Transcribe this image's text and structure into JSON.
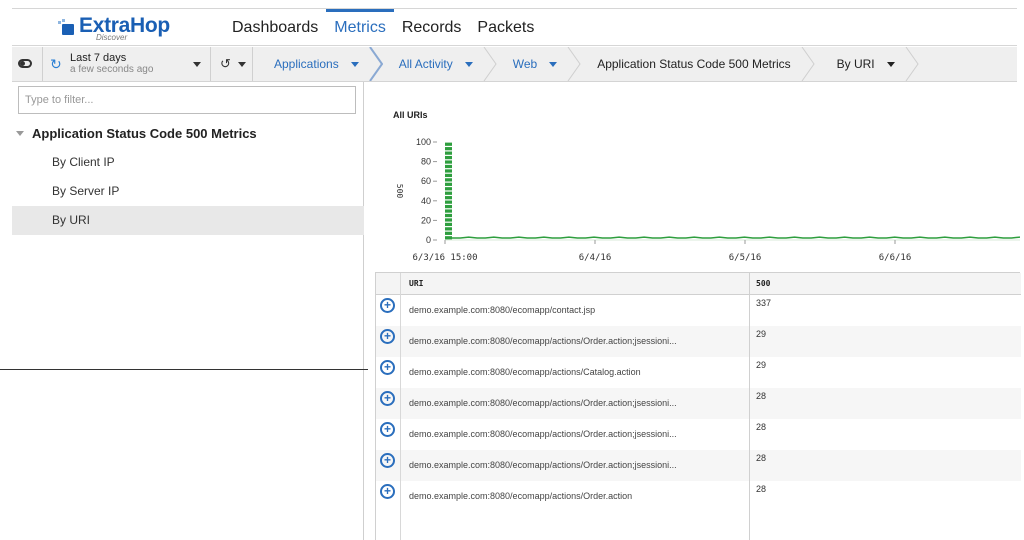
{
  "header": {
    "logo_text": "ExtraHop",
    "logo_sub": "Discover",
    "nav": [
      {
        "label": "Dashboards"
      },
      {
        "label": "Metrics"
      },
      {
        "label": "Records"
      },
      {
        "label": "Packets"
      }
    ],
    "active_nav": "Metrics",
    "brand_color": "#1a5fb4"
  },
  "toolbar": {
    "time_range": "Last 7 days",
    "time_updated": "a few seconds ago",
    "breadcrumbs": [
      {
        "label": "Applications",
        "has_dropdown": true
      },
      {
        "label": "All Activity",
        "has_dropdown": true
      },
      {
        "label": "Web",
        "has_dropdown": true
      },
      {
        "label": "Application Status Code 500 Metrics",
        "has_dropdown": false
      },
      {
        "label": "By URI",
        "has_dropdown": true
      }
    ]
  },
  "sidebar": {
    "filter_placeholder": "Type to filter...",
    "root_label": "Application Status Code 500 Metrics",
    "items": [
      {
        "label": "By Client IP"
      },
      {
        "label": "By Server IP"
      },
      {
        "label": "By URI",
        "selected": true
      }
    ]
  },
  "chart_data": {
    "type": "bar",
    "title": "All URIs",
    "ylabel": "500",
    "ylim": [
      0,
      100
    ],
    "yticks": [
      0,
      20,
      40,
      60,
      80,
      100
    ],
    "xticks": [
      "6/3/16 15:00",
      "6/4/16",
      "6/5/16",
      "6/6/16"
    ],
    "series": [
      {
        "values": [
          100,
          2,
          2,
          3,
          2,
          2,
          3,
          2,
          2,
          3,
          2,
          2,
          3,
          2,
          2,
          3,
          2,
          2,
          3,
          2,
          2,
          3,
          2,
          2,
          3,
          2,
          2,
          3,
          2,
          2,
          3,
          2,
          2,
          3,
          2,
          2,
          3,
          2,
          2,
          3,
          2,
          2,
          3,
          2,
          2,
          3,
          2,
          2,
          3,
          2,
          2,
          3,
          2,
          2,
          3,
          2,
          2,
          3,
          2,
          2,
          3,
          2,
          2,
          3,
          2,
          2,
          3,
          2,
          2,
          3
        ]
      }
    ],
    "color": "#2e9e3e"
  },
  "table": {
    "columns": [
      "URI",
      "500"
    ],
    "rows": [
      {
        "uri": "demo.example.com:8080/ecomapp/contact.jsp",
        "value": "337"
      },
      {
        "uri": "demo.example.com:8080/ecomapp/actions/Order.action;jsessioni...",
        "value": "29"
      },
      {
        "uri": "demo.example.com:8080/ecomapp/actions/Catalog.action",
        "value": "29"
      },
      {
        "uri": "demo.example.com:8080/ecomapp/actions/Order.action;jsessioni...",
        "value": "28"
      },
      {
        "uri": "demo.example.com:8080/ecomapp/actions/Order.action;jsessioni...",
        "value": "28"
      },
      {
        "uri": "demo.example.com:8080/ecomapp/actions/Order.action;jsessioni...",
        "value": "28"
      },
      {
        "uri": "demo.example.com:8080/ecomapp/actions/Order.action",
        "value": "28"
      }
    ]
  }
}
